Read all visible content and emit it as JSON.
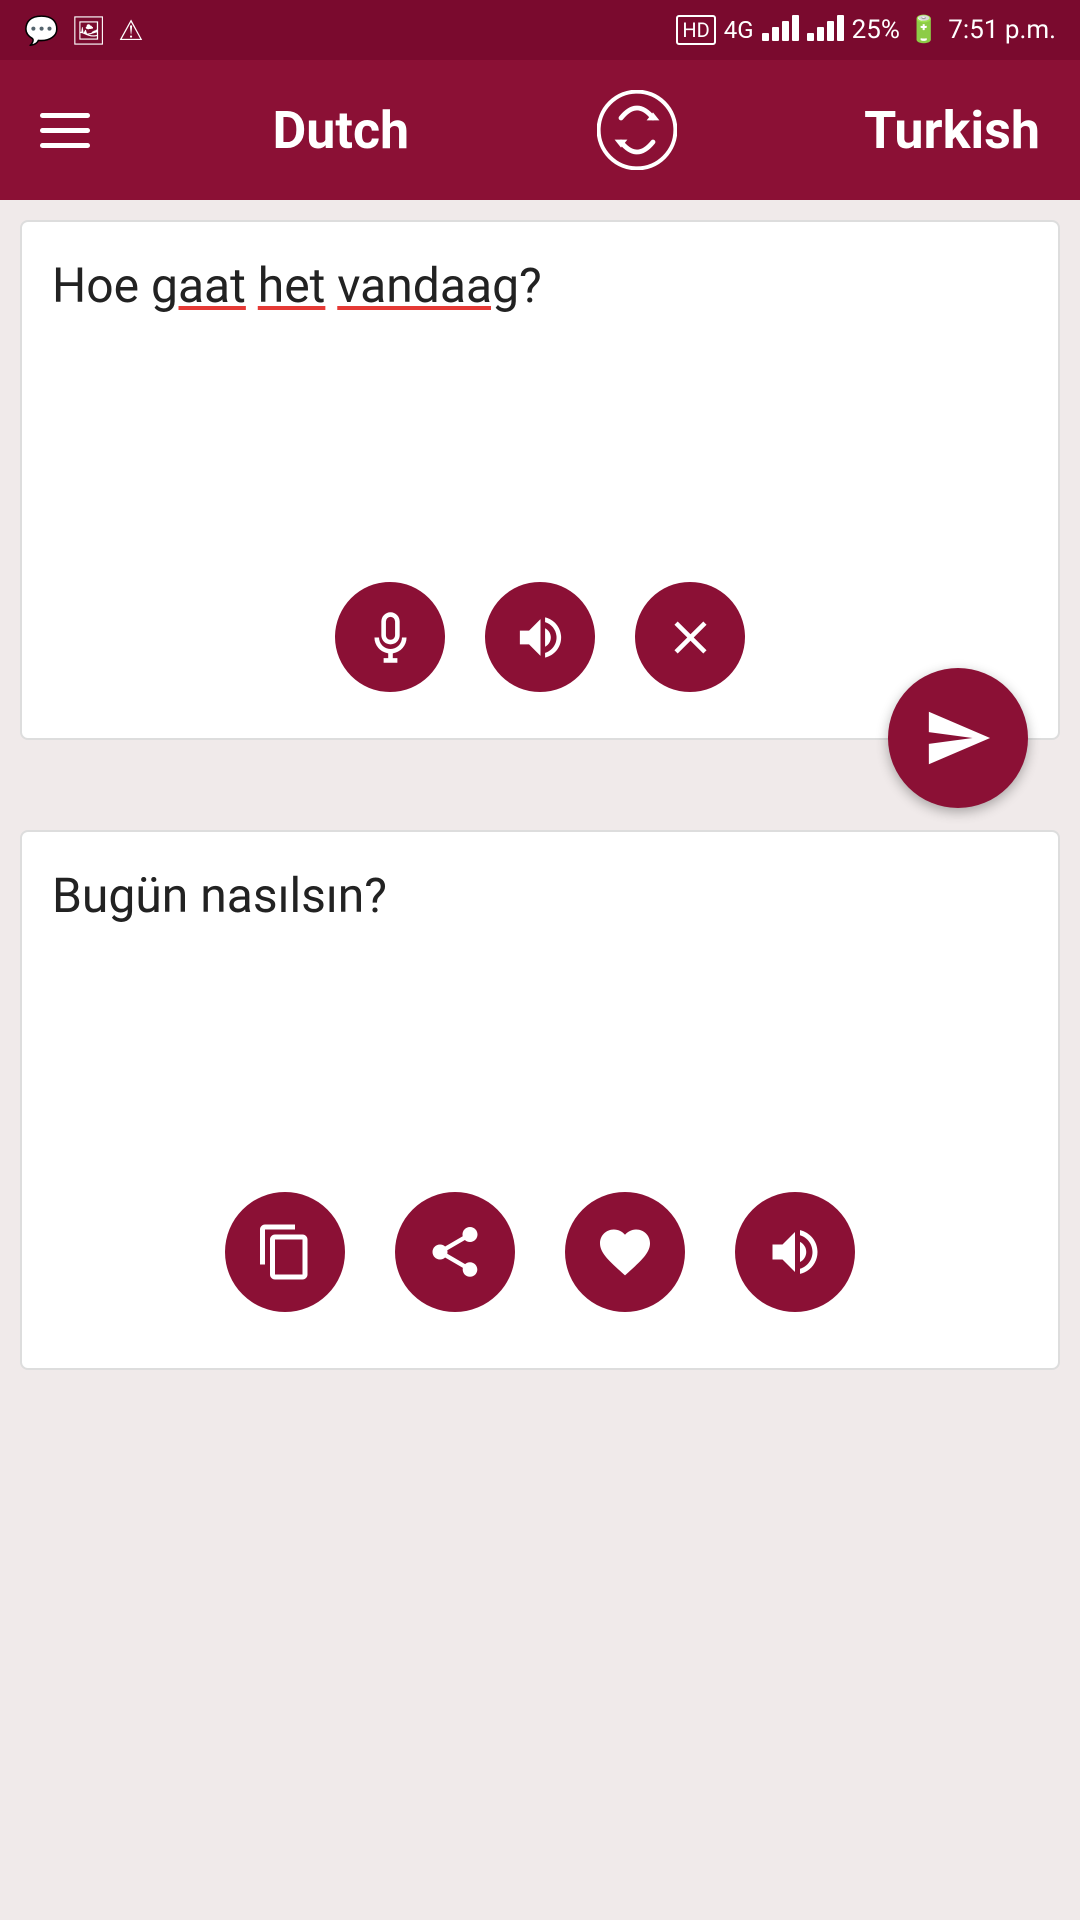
{
  "statusBar": {
    "time": "7:51 p.m.",
    "battery": "25%",
    "network": "4G",
    "icons": [
      "whatsapp-icon",
      "gallery-icon",
      "alert-icon"
    ]
  },
  "header": {
    "menu_label": "Menu",
    "source_language": "Dutch",
    "target_language": "Turkish",
    "swap_label": "Swap languages"
  },
  "sourcePanel": {
    "text": "Hoe gaat het vandaag?",
    "text_plain": "Hoe  het ?",
    "underlined_words": [
      "gaat",
      "het",
      "vandaag"
    ],
    "controls": {
      "mic_label": "Microphone",
      "speaker_label": "Speaker",
      "clear_label": "Clear"
    }
  },
  "translateButton": {
    "label": "Translate"
  },
  "outputPanel": {
    "text": "Bugün nasılsın?",
    "controls": {
      "copy_label": "Copy",
      "share_label": "Share",
      "favorite_label": "Favorite",
      "speaker_label": "Speaker"
    }
  }
}
